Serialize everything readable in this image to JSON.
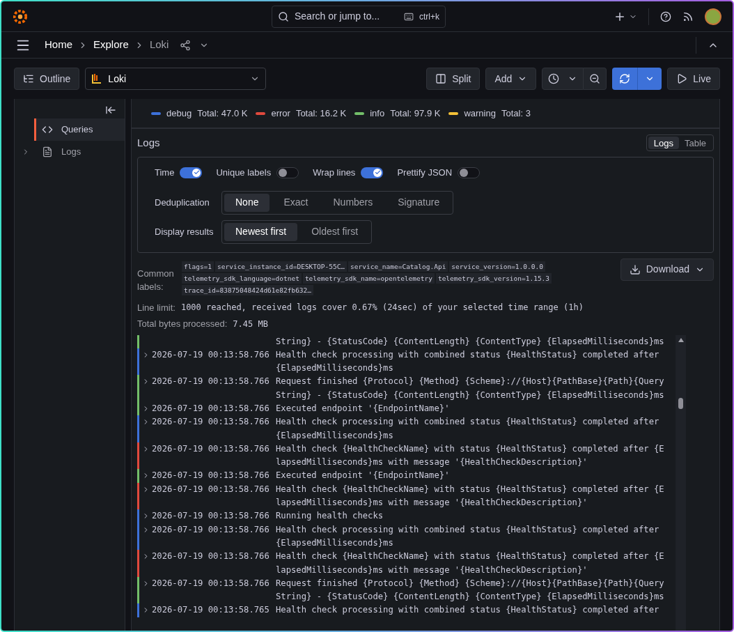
{
  "topbar": {
    "search": {
      "placeholder": "Search or jump to..."
    },
    "shortcut": "ctrl+k"
  },
  "breadcrumbs": [
    {
      "label": "Home",
      "current": false
    },
    {
      "label": "Explore",
      "current": false
    },
    {
      "label": "Loki",
      "current": true
    }
  ],
  "toolbar": {
    "outline": "Outline",
    "datasource": "Loki",
    "split": "Split",
    "add": "Add",
    "live": "Live"
  },
  "sidebar": {
    "items": [
      {
        "label": "Queries",
        "selected": true,
        "kind": "code"
      },
      {
        "label": "Logs",
        "selected": false,
        "kind": "log",
        "expanded": false
      }
    ]
  },
  "legend": [
    {
      "name": "debug",
      "total": "Total: 47.0 K",
      "color": "#3d71d9"
    },
    {
      "name": "error",
      "total": "Total: 16.2 K",
      "color": "#e0493d"
    },
    {
      "name": "info",
      "total": "Total: 97.9 K",
      "color": "#73bf69"
    },
    {
      "name": "warning",
      "total": "Total: 3",
      "color": "#f2c037"
    }
  ],
  "logs_panel": {
    "title": "Logs",
    "view_tabs": [
      {
        "label": "Logs",
        "selected": true
      },
      {
        "label": "Table",
        "selected": false
      }
    ],
    "toggles": [
      {
        "label": "Time",
        "on": true
      },
      {
        "label": "Unique labels",
        "on": false
      },
      {
        "label": "Wrap lines",
        "on": true
      },
      {
        "label": "Prettify JSON",
        "on": false
      }
    ],
    "deduplication": {
      "label": "Deduplication",
      "options": [
        {
          "label": "None",
          "selected": true
        },
        {
          "label": "Exact",
          "selected": false
        },
        {
          "label": "Numbers",
          "selected": false
        },
        {
          "label": "Signature",
          "selected": false
        }
      ]
    },
    "display_results": {
      "label": "Display results",
      "options": [
        {
          "label": "Newest first",
          "selected": true
        },
        {
          "label": "Oldest first",
          "selected": false
        }
      ]
    },
    "common_labels": {
      "label": "Common labels:",
      "values": [
        "flags=1",
        "service_instance_id=DESKTOP-55C…",
        "service_name=Catalog.Api",
        "service_version=1.0.0.0",
        "telemetry_sdk_language=dotnet",
        "telemetry_sdk_name=opentelemetry",
        "telemetry_sdk_version=1.15.3",
        "trace_id=83875048424d61e82fb632…"
      ]
    },
    "download": "Download",
    "line_limit": {
      "label": "Line limit:",
      "value": "1000 reached, received logs cover 0.67% (24sec) of your selected time range (1h)"
    },
    "bytes": {
      "label": "Total bytes processed:",
      "value": "7.45 MB"
    },
    "rows": [
      {
        "color": "#73bf69",
        "lines": [
          "String} - {StatusCode} {ContentLength} {ContentType} {ElapsedMilliseconds}ms"
        ]
      },
      {
        "color": "#3d71d9",
        "timestamp": "2026-07-19 00:13:58.766",
        "lines": [
          "Health check processing with combined status {HealthStatus} completed after",
          "{ElapsedMilliseconds}ms"
        ]
      },
      {
        "color": "#73bf69",
        "timestamp": "2026-07-19 00:13:58.766",
        "lines": [
          "Request finished {Protocol} {Method} {Scheme}://{Host}{PathBase}{Path}{Query",
          "String} - {StatusCode} {ContentLength} {ContentType} {ElapsedMilliseconds}ms"
        ]
      },
      {
        "color": "#73bf69",
        "timestamp": "2026-07-19 00:13:58.766",
        "lines": [
          "Executed endpoint '{EndpointName}'"
        ]
      },
      {
        "color": "#3d71d9",
        "timestamp": "2026-07-19 00:13:58.766",
        "lines": [
          "Health check processing with combined status {HealthStatus} completed after",
          "{ElapsedMilliseconds}ms"
        ]
      },
      {
        "color": "#e0493d",
        "timestamp": "2026-07-19 00:13:58.766",
        "lines": [
          "Health check {HealthCheckName} with status {HealthStatus} completed after {E",
          "lapsedMilliseconds}ms with message '{HealthCheckDescription}'"
        ]
      },
      {
        "color": "#73bf69",
        "timestamp": "2026-07-19 00:13:58.766",
        "lines": [
          "Executed endpoint '{EndpointName}'"
        ]
      },
      {
        "color": "#e0493d",
        "timestamp": "2026-07-19 00:13:58.766",
        "lines": [
          "Health check {HealthCheckName} with status {HealthStatus} completed after {E",
          "lapsedMilliseconds}ms with message '{HealthCheckDescription}'"
        ]
      },
      {
        "color": "#3d71d9",
        "timestamp": "2026-07-19 00:13:58.766",
        "lines": [
          "Running health checks"
        ]
      },
      {
        "color": "#3d71d9",
        "timestamp": "2026-07-19 00:13:58.766",
        "lines": [
          "Health check processing with combined status {HealthStatus} completed after",
          "{ElapsedMilliseconds}ms"
        ]
      },
      {
        "color": "#e0493d",
        "timestamp": "2026-07-19 00:13:58.766",
        "lines": [
          "Health check {HealthCheckName} with status {HealthStatus} completed after {E",
          "lapsedMilliseconds}ms with message '{HealthCheckDescription}'"
        ]
      },
      {
        "color": "#73bf69",
        "timestamp": "2026-07-19 00:13:58.766",
        "lines": [
          "Request finished {Protocol} {Method} {Scheme}://{Host}{PathBase}{Path}{Query",
          "String} - {StatusCode} {ContentLength} {ContentType} {ElapsedMilliseconds}ms"
        ]
      },
      {
        "color": "#3d71d9",
        "timestamp": "2026-07-19 00:13:58.765",
        "lines": [
          "Health check processing with combined status {HealthStatus} completed after"
        ]
      }
    ]
  }
}
